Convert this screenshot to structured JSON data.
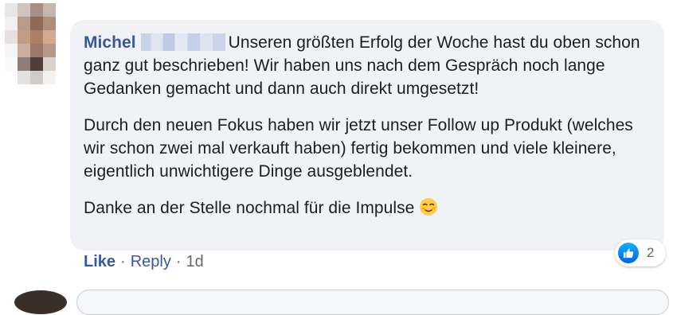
{
  "comment": {
    "author": "Michel",
    "author_blurred": true,
    "paragraphs": [
      "Unseren größten Erfolg der Woche hast du oben schon ganz gut beschrieben! Wir haben uns nach dem Gespräch noch lange Gedanken gemacht und dann auch direkt umgesetzt!",
      "Durch den neuen Fokus haben wir jetzt unser Follow up Produkt (welches wir schon zwei mal verkauft haben) fertig bekommen und viele kleinere, eigentlich unwichtigere Dinge ausgeblendet.",
      "Danke an der Stelle nochmal für die Impulse"
    ],
    "emoji": "relieved-face-emoji"
  },
  "reactions": {
    "icon": "thumbs-up-icon",
    "count": "2"
  },
  "actions": {
    "like_label": "Like",
    "separator": "·",
    "reply_label": "Reply",
    "time": "1d"
  },
  "colors": {
    "bubble_bg": "#f0f2f5",
    "author": "#385898",
    "link": "#385898",
    "meta": "#65676b",
    "like_blue": "#1877f2"
  }
}
